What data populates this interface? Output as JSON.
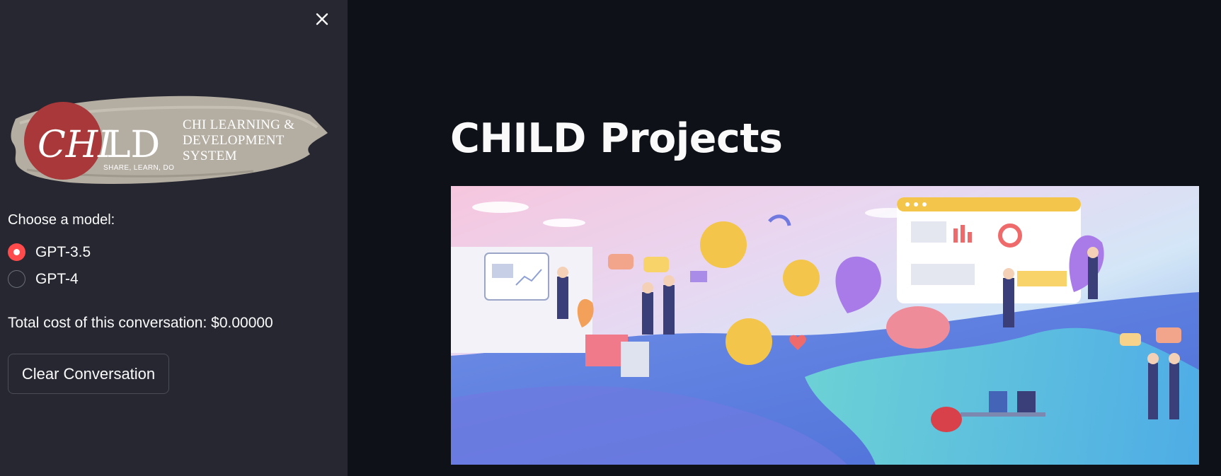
{
  "sidebar": {
    "logo": {
      "monogram": "CHILD",
      "line1": "CHI LEARNING &",
      "line2": "DEVELOPMENT",
      "line3": "SYSTEM",
      "tagline": "SHARE, LEARN, DO"
    },
    "model_label": "Choose a model:",
    "models": [
      {
        "label": "GPT-3.5",
        "selected": true
      },
      {
        "label": "GPT-4",
        "selected": false
      }
    ],
    "cost_text": "Total cost of this conversation: $0.00000",
    "clear_button": "Clear Conversation"
  },
  "main": {
    "title": "CHILD Projects"
  },
  "colors": {
    "sidebar_bg": "#262730",
    "main_bg": "#0e1117",
    "accent": "#ff4b4b"
  },
  "icons": {
    "close": "close-icon"
  }
}
